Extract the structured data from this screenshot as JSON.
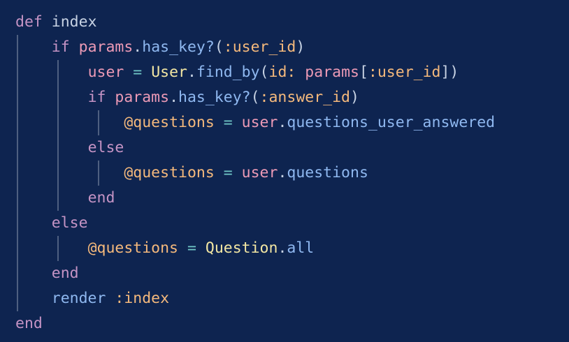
{
  "editor": {
    "background": "#0e2450",
    "language": "ruby",
    "lines": [
      {
        "tokens": [
          [
            "kw",
            "def"
          ],
          [
            "plain",
            " index"
          ]
        ]
      },
      {
        "tokens": [
          [
            "plain",
            "    "
          ],
          [
            "kw",
            "if"
          ],
          [
            "plain",
            " "
          ],
          [
            "var",
            "params"
          ],
          [
            "punct",
            "."
          ],
          [
            "fn",
            "has_key?"
          ],
          [
            "punct",
            "("
          ],
          [
            "sym",
            ":user_id"
          ],
          [
            "punct",
            ")"
          ]
        ]
      },
      {
        "tokens": [
          [
            "plain",
            "        "
          ],
          [
            "var",
            "user"
          ],
          [
            "plain",
            " "
          ],
          [
            "op",
            "="
          ],
          [
            "plain",
            " "
          ],
          [
            "cls",
            "User"
          ],
          [
            "punct",
            "."
          ],
          [
            "fn",
            "find_by"
          ],
          [
            "punct",
            "("
          ],
          [
            "sym",
            "id:"
          ],
          [
            "plain",
            " "
          ],
          [
            "var",
            "params"
          ],
          [
            "punct",
            "["
          ],
          [
            "sym",
            ":user_id"
          ],
          [
            "punct",
            "])"
          ]
        ]
      },
      {
        "tokens": [
          [
            "plain",
            "        "
          ],
          [
            "kw",
            "if"
          ],
          [
            "plain",
            " "
          ],
          [
            "var",
            "params"
          ],
          [
            "punct",
            "."
          ],
          [
            "fn",
            "has_key?"
          ],
          [
            "punct",
            "("
          ],
          [
            "sym",
            ":answer_id"
          ],
          [
            "punct",
            ")"
          ]
        ]
      },
      {
        "tokens": [
          [
            "plain",
            "            "
          ],
          [
            "ivar",
            "@questions"
          ],
          [
            "plain",
            " "
          ],
          [
            "op",
            "="
          ],
          [
            "plain",
            " "
          ],
          [
            "var",
            "user"
          ],
          [
            "punct",
            "."
          ],
          [
            "fn",
            "questions_user_answered"
          ]
        ]
      },
      {
        "tokens": [
          [
            "plain",
            "        "
          ],
          [
            "kw",
            "else"
          ]
        ]
      },
      {
        "tokens": [
          [
            "plain",
            "            "
          ],
          [
            "ivar",
            "@questions"
          ],
          [
            "plain",
            " "
          ],
          [
            "op",
            "="
          ],
          [
            "plain",
            " "
          ],
          [
            "var",
            "user"
          ],
          [
            "punct",
            "."
          ],
          [
            "fn",
            "questions"
          ]
        ]
      },
      {
        "tokens": [
          [
            "plain",
            "        "
          ],
          [
            "kw",
            "end"
          ]
        ]
      },
      {
        "tokens": [
          [
            "plain",
            "    "
          ],
          [
            "kw",
            "else"
          ]
        ]
      },
      {
        "tokens": [
          [
            "plain",
            "        "
          ],
          [
            "ivar",
            "@questions"
          ],
          [
            "plain",
            " "
          ],
          [
            "op",
            "="
          ],
          [
            "plain",
            " "
          ],
          [
            "cls",
            "Question"
          ],
          [
            "punct",
            "."
          ],
          [
            "fn",
            "all"
          ]
        ]
      },
      {
        "tokens": [
          [
            "plain",
            "    "
          ],
          [
            "kw",
            "end"
          ]
        ]
      },
      {
        "tokens": [
          [
            "plain",
            "    "
          ],
          [
            "fn",
            "render"
          ],
          [
            "plain",
            " "
          ],
          [
            "sym",
            ":index"
          ]
        ]
      },
      {
        "tokens": [
          [
            "kw",
            "end"
          ]
        ]
      }
    ]
  }
}
